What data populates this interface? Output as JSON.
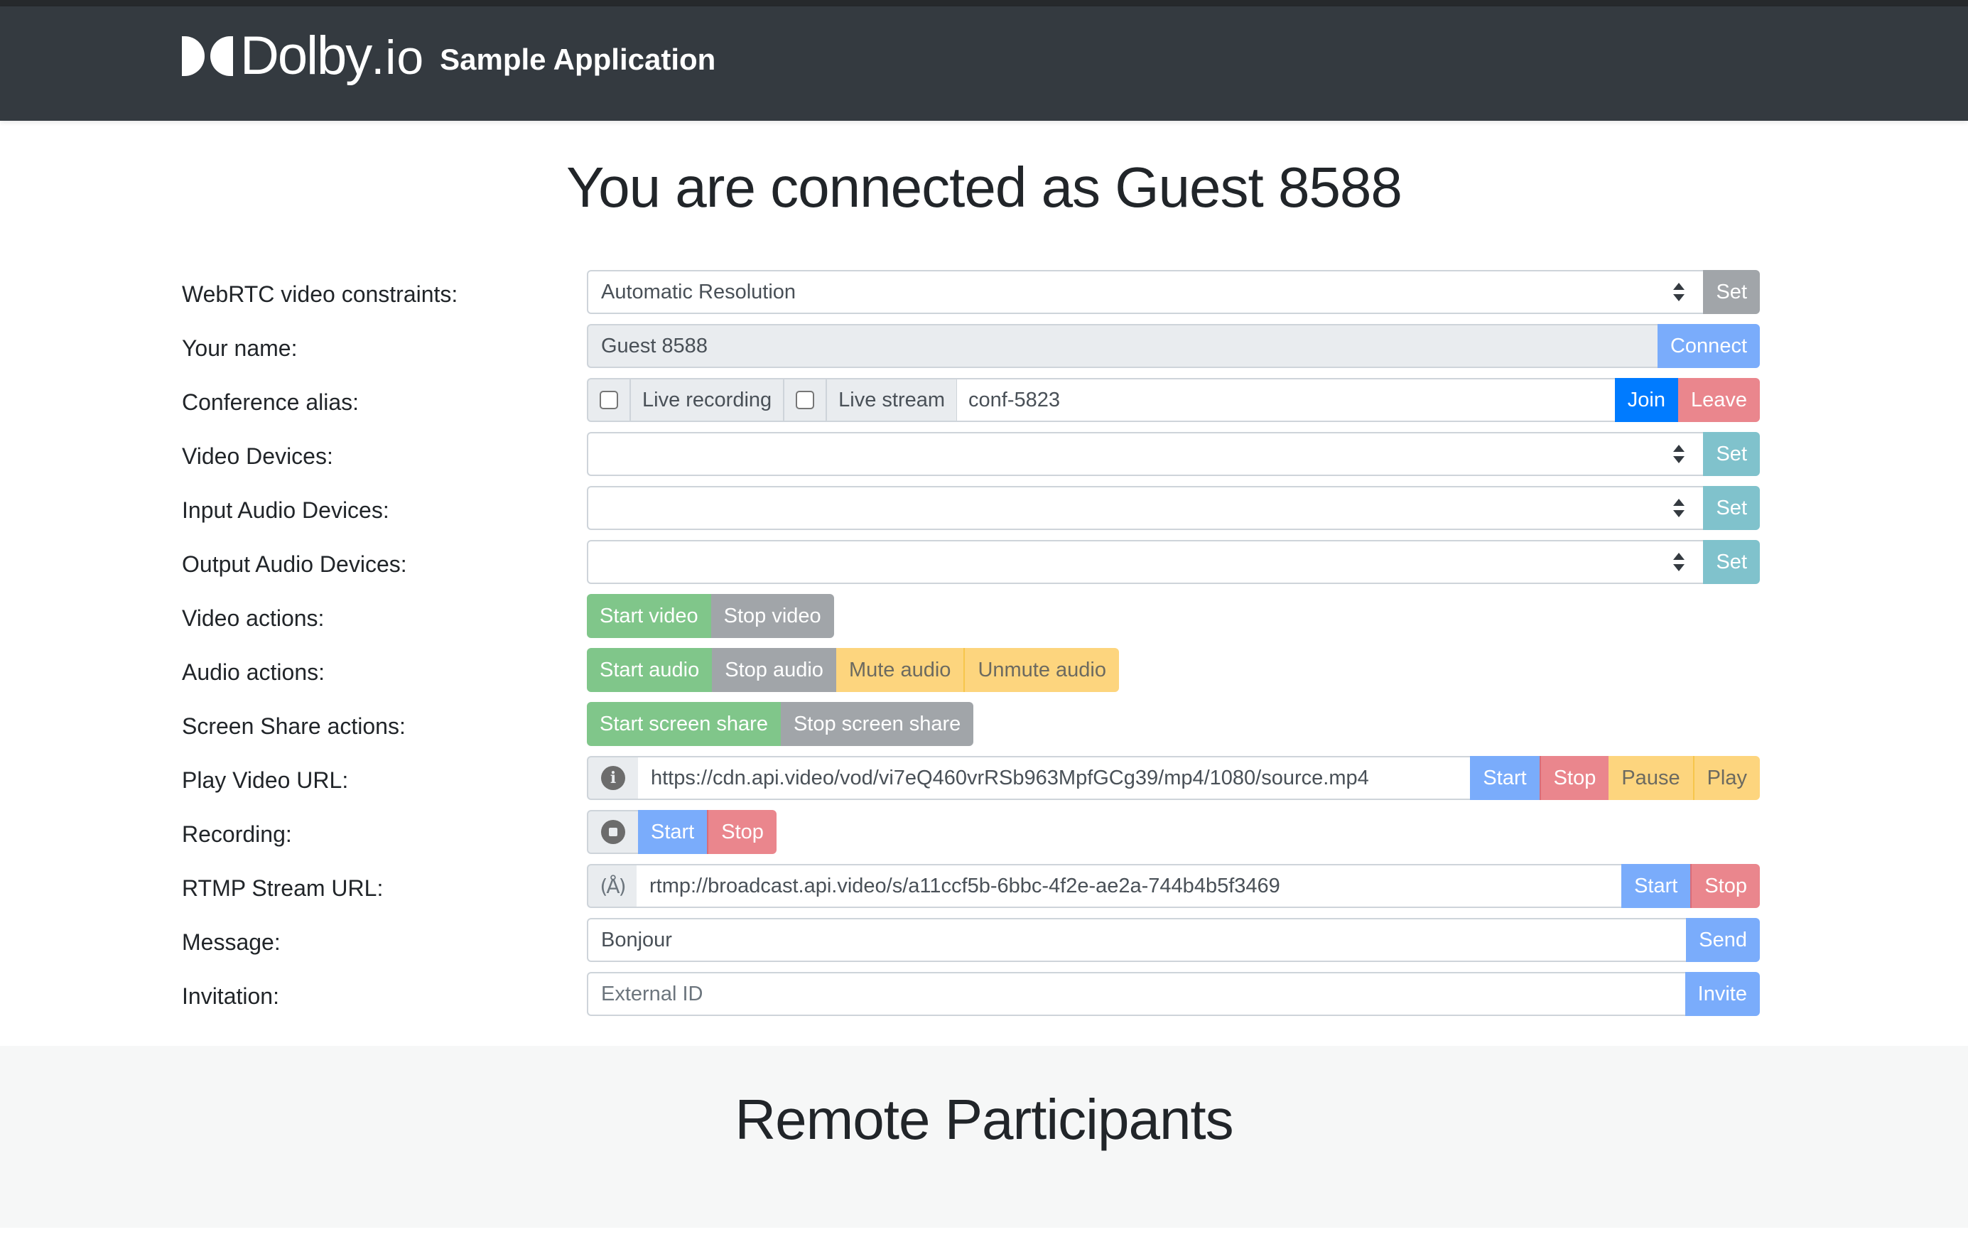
{
  "header": {
    "brand": "Dolby",
    "brand_suffix": ".io",
    "app_title": "Sample Application"
  },
  "main": {
    "title": "You are connected as Guest 8588"
  },
  "form": {
    "video_constraints": {
      "label": "WebRTC video constraints:",
      "selected": "Automatic Resolution",
      "button": "Set"
    },
    "name": {
      "label": "Your name:",
      "value": "Guest 8588",
      "button": "Connect"
    },
    "conference": {
      "label": "Conference alias:",
      "live_recording_label": "Live recording",
      "live_recording_checked": false,
      "live_stream_label": "Live stream",
      "live_stream_checked": false,
      "alias_value": "conf-5823",
      "join_button": "Join",
      "leave_button": "Leave"
    },
    "video_devices": {
      "label": "Video Devices:",
      "selected": "",
      "button": "Set"
    },
    "input_audio_devices": {
      "label": "Input Audio Devices:",
      "selected": "",
      "button": "Set"
    },
    "output_audio_devices": {
      "label": "Output Audio Devices:",
      "selected": "",
      "button": "Set"
    },
    "video_actions": {
      "label": "Video actions:",
      "start": "Start video",
      "stop": "Stop video"
    },
    "audio_actions": {
      "label": "Audio actions:",
      "start": "Start audio",
      "stop": "Stop audio",
      "mute": "Mute audio",
      "unmute": "Unmute audio"
    },
    "screen_share_actions": {
      "label": "Screen Share actions:",
      "start": "Start screen share",
      "stop": "Stop screen share"
    },
    "play_video_url": {
      "label": "Play Video URL:",
      "icon": "info-icon",
      "value": "https://cdn.api.video/vod/vi7eQ460vrRSb963MpfGCg39/mp4/1080/source.mp4",
      "start": "Start",
      "stop": "Stop",
      "pause": "Pause",
      "play": "Play"
    },
    "recording": {
      "label": "Recording:",
      "icon": "stop-circle-icon",
      "start": "Start",
      "stop": "Stop"
    },
    "rtmp": {
      "label": "RTMP Stream URL:",
      "icon": "broadcast-antenna-icon",
      "value": "rtmp://broadcast.api.video/s/a11ccf5b-6bbc-4f2e-ae2a-744b4b5f3469",
      "start": "Start",
      "stop": "Stop"
    },
    "message": {
      "label": "Message:",
      "value": "Bonjour",
      "button": "Send"
    },
    "invitation": {
      "label": "Invitation:",
      "placeholder": "External ID",
      "value": "",
      "button": "Invite"
    }
  },
  "participants": {
    "title": "Remote Participants"
  },
  "colors": {
    "navbar": "#343a40",
    "primary": "#007bff",
    "primary_light": "#7aacfb",
    "danger_light": "#ea868d",
    "success_light": "#80c68a",
    "secondary_light": "#a1a5a9",
    "warning_light": "#fdd57e",
    "info_light": "#80c2cc"
  }
}
